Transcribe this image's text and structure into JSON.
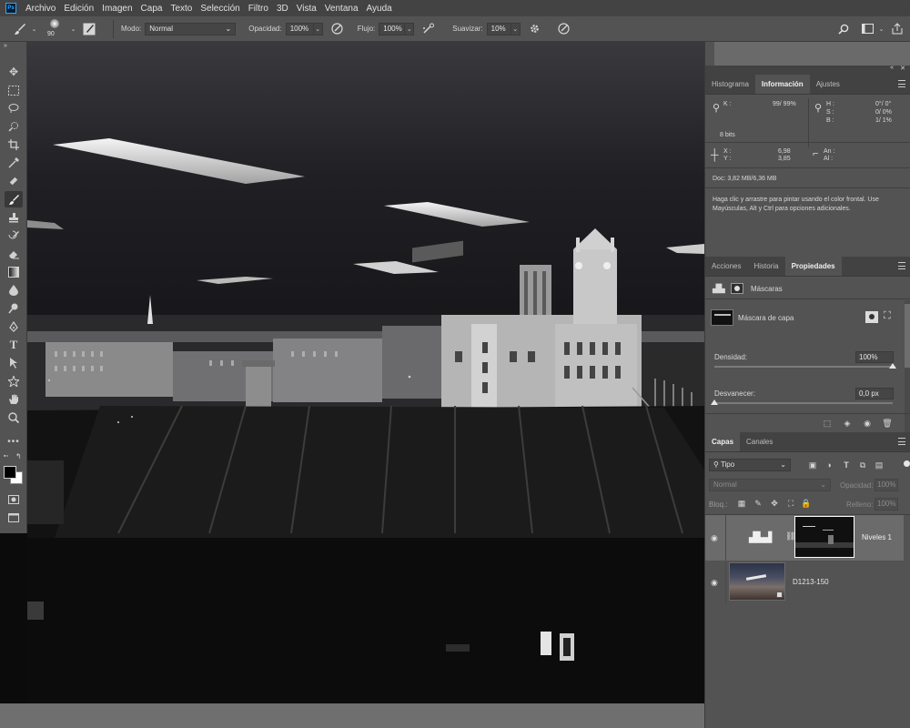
{
  "menubar": {
    "logo": "Ps",
    "items": [
      "Archivo",
      "Edición",
      "Imagen",
      "Capa",
      "Texto",
      "Selección",
      "Filtro",
      "3D",
      "Vista",
      "Ventana",
      "Ayuda"
    ]
  },
  "options": {
    "brush_size": "90",
    "mode_label": "Modo:",
    "mode_value": "Normal",
    "opacity_label": "Opacidad:",
    "opacity_value": "100%",
    "flow_label": "Flujo:",
    "flow_value": "100%",
    "smoothing_label": "Suavizar:",
    "smoothing_value": "10%"
  },
  "info_panel": {
    "tabs": [
      "Histograma",
      "Información",
      "Ajustes"
    ],
    "active_tab": "Información",
    "k_label": "K :",
    "k_value": "99/ 99%",
    "hsb": {
      "h_label": "H :",
      "h_value": "0°/ 0°",
      "s_label": "S :",
      "s_value": "0/ 0%",
      "b_label": "B :",
      "b_value": "1/ 1%"
    },
    "bits": "8 bits",
    "x_label": "X :",
    "x_value": "6,98",
    "y_label": "Y :",
    "y_value": "3,85",
    "an_label": "An :",
    "al_label": "Al :",
    "doc": "Doc: 3,82 MB/6,36 MB",
    "hint": "Haga clic y arrastre para pintar usando el color frontal. Use Mayúsculas, Alt y Ctrl para opciones adicionales."
  },
  "properties_panel": {
    "tabs": [
      "Acciones",
      "Historia",
      "Propiedades"
    ],
    "active_tab": "Propiedades",
    "section": "Máscaras",
    "mask_label": "Máscara de capa",
    "density_label": "Densidad:",
    "density_value": "100%",
    "density_fraction": 1.0,
    "feather_label": "Desvanecer:",
    "feather_value": "0,0 px",
    "feather_fraction": 0.0
  },
  "layers_panel": {
    "tabs": [
      "Capas",
      "Canales"
    ],
    "active_tab": "Capas",
    "filter_kind": "Tipo",
    "blend_mode": "Normal",
    "opacity_label": "Opacidad:",
    "opacity_value": "100%",
    "lock_label": "Bloq.:",
    "fill_label": "Relleno:",
    "fill_value": "100%",
    "layers": [
      {
        "name": "Niveles 1",
        "selected": true
      },
      {
        "name": "D1213-150",
        "selected": false
      }
    ]
  },
  "colors": {
    "menubar": "#434343",
    "panel": "#535353",
    "canvas_sky": "#1e1e22",
    "selected_layer": "#6b6b6b"
  },
  "icons": [
    "brush-icon",
    "mode-airbrush-icon",
    "flow-airbrush-icon",
    "gear-icon",
    "pressure-icon",
    "search-icon",
    "workspace-icon",
    "share-icon",
    "eye-icon",
    "trash-icon"
  ]
}
